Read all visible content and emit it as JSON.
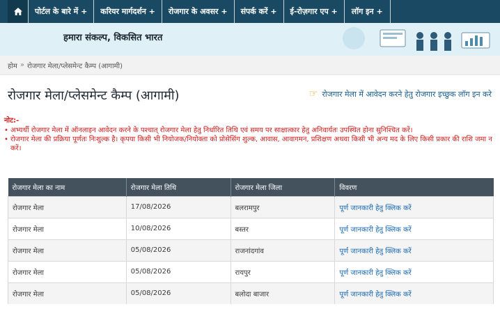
{
  "nav": {
    "items": [
      {
        "label": "पोर्टल के बारे में +"
      },
      {
        "label": "करियर मार्गदर्शन +"
      },
      {
        "label": "रोजगार के अवसर +"
      },
      {
        "label": "संपर्क करें +"
      },
      {
        "label": "ई-रोज़गार एप +"
      },
      {
        "label": "लॉग इन +"
      }
    ]
  },
  "banner": {
    "tagline": "हमारा संकल्प, विकसित भारत"
  },
  "breadcrumb": {
    "home": "होम",
    "separator": "»",
    "current": "रोजगार मेला/प्लेसमेन्ट कैम्प (आगामी)"
  },
  "page": {
    "title": "रोजगार मेला/प्लेसमेन्ट कैम्प (आगामी)",
    "apply_link": "रोजगार मेला में आवेदन करने हेतु रोजगार इच्छुक लॉग इन करे"
  },
  "note": {
    "title": "नोट:-",
    "items": [
      "अभ्यर्थी रोजगार मेला में ऑनलाइन आवेदन करने के पश्चात् रोजगार मेला हेतु निर्धारित तिथि एवं समय पर साक्षात्कार हेतु अनिवार्यतः उपस्थित होना सुनिश्चित करें।",
      "रोजगार मेला की प्रक्रिया पूर्णतः निःशुल्क है। कृपया किसी भी नियोजक/नियोक्ता को प्रोसेसिंग शुल्क, आवास, आवागमन, प्रशिक्षण अथवा किसी भी अन्य मद के लिए किसी प्रकार की राशि जमा न करें।"
    ]
  },
  "table": {
    "headers": [
      "रोजगार मेला का नाम",
      "रोजगार मेला तिथि",
      "रोजगार मेला जिला",
      "विवरण"
    ],
    "rows": [
      {
        "name": "रोजगार मेला",
        "date": "17/08/2026",
        "district": "बलरामपुर",
        "link": "पूर्ण जानकारी हेतु क्लिक करें"
      },
      {
        "name": "रोजगार मेला",
        "date": "10/08/2026",
        "district": "बस्तर",
        "link": "पूर्ण जानकारी हेतु क्लिक करें"
      },
      {
        "name": "रोजगार मेला",
        "date": "05/08/2026",
        "district": "राजनांदगांव",
        "link": "पूर्ण जानकारी हेतु क्लिक करें"
      },
      {
        "name": "रोजगार मेला",
        "date": "05/08/2026",
        "district": "रायपुर",
        "link": "पूर्ण जानकारी हेतु क्लिक करें"
      },
      {
        "name": "रोजगार मेला",
        "date": "05/08/2026",
        "district": "बलोदा बाजार",
        "link": "पूर्ण जानकारी हेतु क्लिक करें"
      }
    ]
  },
  "icons": {
    "home": "home-icon",
    "pointer": "pointing-hand-icon"
  }
}
